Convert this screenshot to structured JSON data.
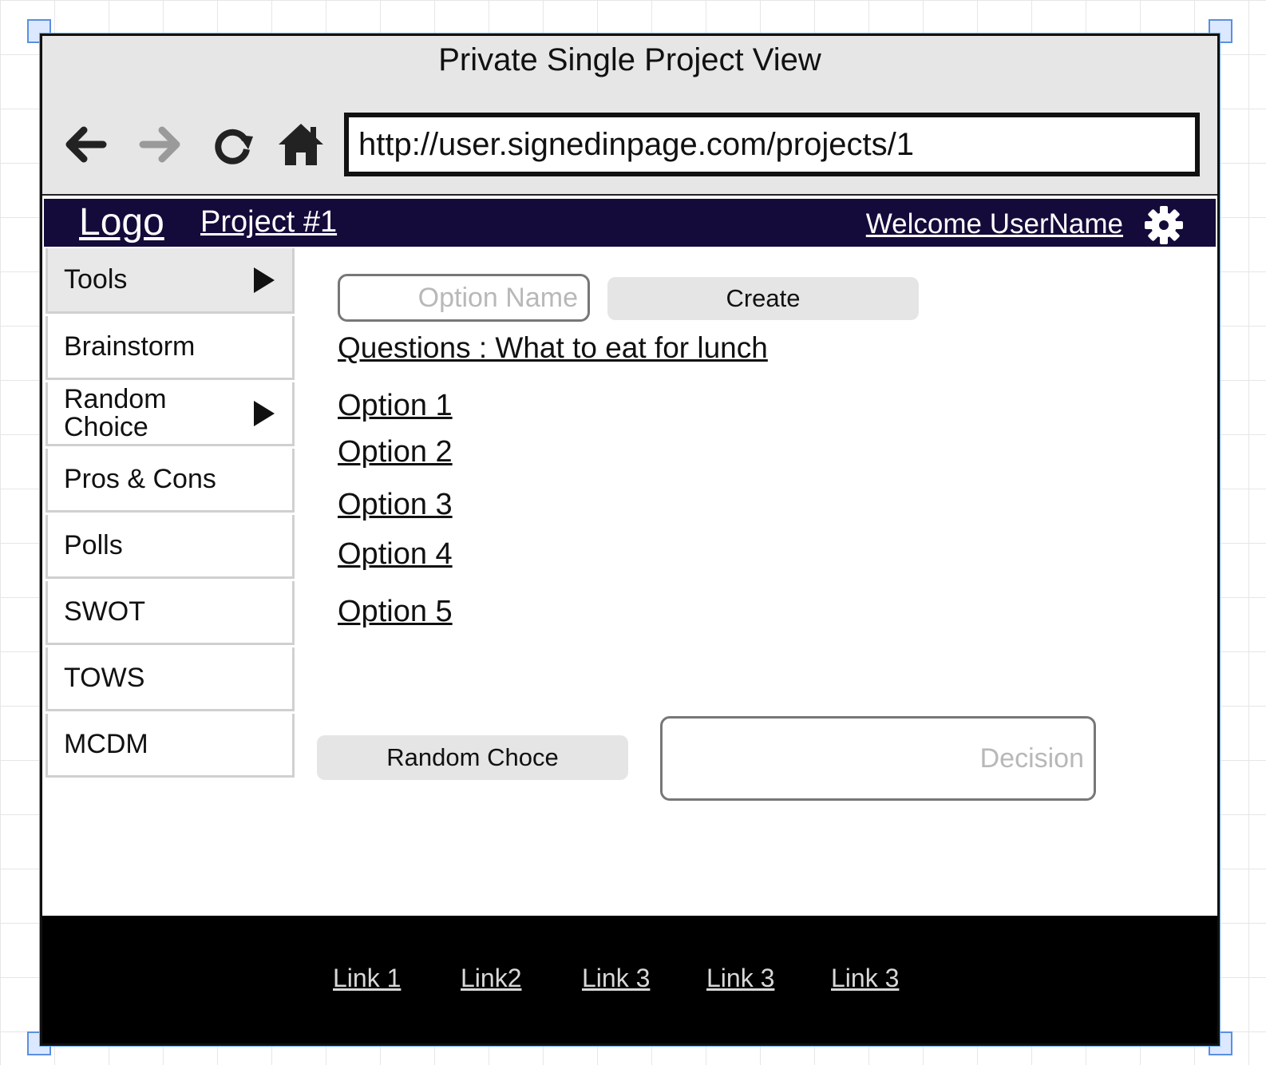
{
  "window": {
    "title": "Private Single Project View",
    "url": "http://user.signedinpage.com/projects/1"
  },
  "nav": {
    "back_icon": "arrow-left-icon",
    "forward_icon": "arrow-right-icon",
    "reload_icon": "reload-icon",
    "home_icon": "home-icon"
  },
  "header": {
    "logo": "Logo",
    "project": "Project #1",
    "welcome": "Welcome UserName",
    "settings_icon": "gear-icon",
    "background": "#140b3a"
  },
  "sidebar": {
    "items": [
      {
        "label": "Tools",
        "has_submenu": true
      },
      {
        "label": "Brainstorm"
      },
      {
        "label_line1": "Random",
        "label_line2": "Choice",
        "has_submenu": true
      },
      {
        "label": "Pros & Cons"
      },
      {
        "label": "Polls"
      },
      {
        "label": "SWOT"
      },
      {
        "label": "TOWS"
      },
      {
        "label": "MCDM"
      }
    ]
  },
  "main": {
    "option_name_placeholder": "Option Name",
    "create_label": "Create",
    "question": "Questions : What to eat for lunch",
    "options": [
      "Option 1",
      "Option 2",
      "Option 3",
      "Option 4",
      "Option 5"
    ],
    "random_choice_label": "Random Choce",
    "decision_placeholder": "Decision"
  },
  "footer": {
    "links": [
      "Link 1",
      "Link2",
      "Link 3",
      "Link 3",
      "Link 3"
    ]
  }
}
